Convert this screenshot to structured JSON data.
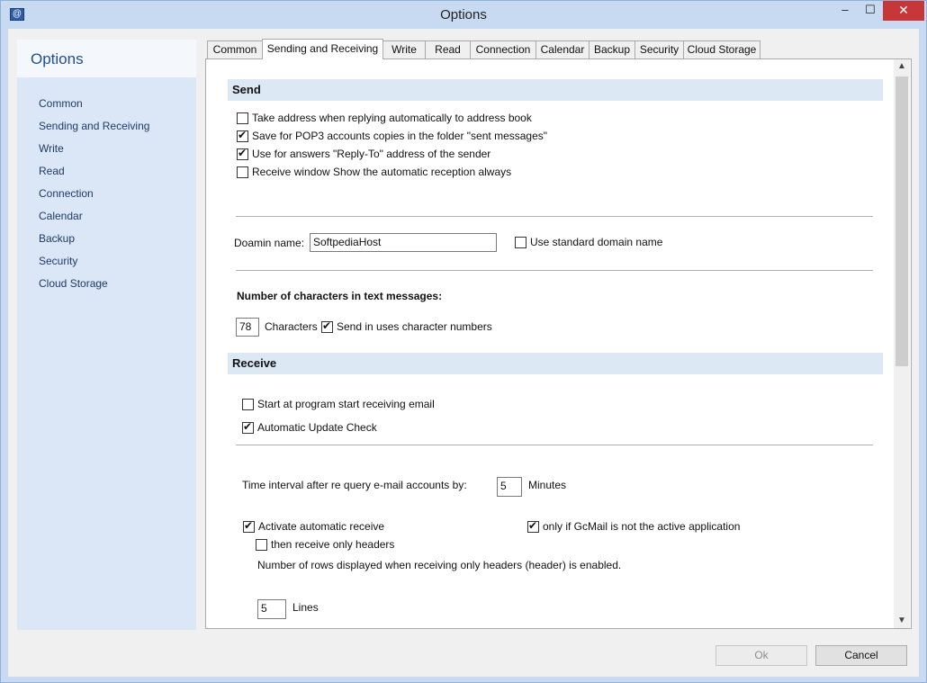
{
  "window": {
    "title": "Options",
    "icon": "app-icon",
    "min_glyph": "–",
    "max_glyph": "☐",
    "close_glyph": "✕"
  },
  "sidebar": {
    "title": "Options",
    "items": [
      {
        "label": "Common"
      },
      {
        "label": "Sending and Receiving"
      },
      {
        "label": "Write"
      },
      {
        "label": "Read"
      },
      {
        "label": "Connection"
      },
      {
        "label": "Calendar"
      },
      {
        "label": "Backup"
      },
      {
        "label": "Security"
      },
      {
        "label": "Cloud Storage"
      }
    ]
  },
  "tabs": [
    {
      "label": "Common"
    },
    {
      "label": "Sending and Receiving",
      "active": true
    },
    {
      "label": "Write"
    },
    {
      "label": "Read"
    },
    {
      "label": "Connection"
    },
    {
      "label": "Calendar"
    },
    {
      "label": "Backup"
    },
    {
      "label": "Security"
    },
    {
      "label": "Cloud Storage"
    }
  ],
  "send": {
    "header": "Send",
    "options": [
      {
        "label": "Take address when replying automatically to address book",
        "checked": false
      },
      {
        "label": "Save for POP3 accounts copies in the folder \"sent messages\"",
        "checked": true
      },
      {
        "label": "Use for answers \"Reply-To\" address of the sender",
        "checked": true
      },
      {
        "label": "Receive window Show the automatic reception always",
        "checked": false
      }
    ],
    "domain_label": "Doamin name:",
    "domain_value": "SoftpediaHost",
    "standard_domain": {
      "label": "Use standard domain name",
      "checked": false
    },
    "chars_heading": "Number of characters in text messages:",
    "chars_value": "78",
    "chars_unit": "Characters",
    "send_char_numbers": {
      "label": "Send in uses character numbers",
      "checked": true
    }
  },
  "receive": {
    "header": "Receive",
    "start_receiving": {
      "label": "Start at program start receiving email",
      "checked": false
    },
    "update_check": {
      "label": "Automatic Update Check",
      "checked": true
    },
    "interval_label": "Time interval after re query e-mail accounts by:",
    "interval_value": "5",
    "interval_unit": "Minutes",
    "auto_receive": {
      "label": "Activate automatic receive",
      "checked": true
    },
    "only_inactive": {
      "label": "only if GcMail is not the active application",
      "checked": true
    },
    "headers_only": {
      "label": "then receive only headers",
      "checked": false
    },
    "rows_label": "Number of rows displayed when receiving only headers (header) is enabled.",
    "rows_value": "5",
    "rows_unit": "Lines"
  },
  "buttons": {
    "ok": "Ok",
    "cancel": "Cancel"
  },
  "scroll": {
    "up_glyph": "▲",
    "down_glyph": "▼"
  }
}
